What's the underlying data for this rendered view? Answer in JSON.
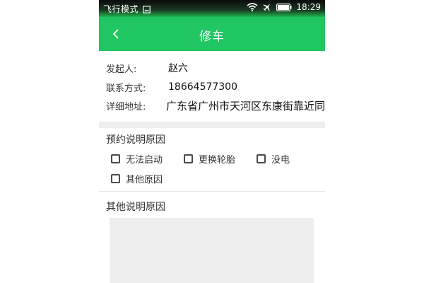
{
  "status_bar": {
    "left_text": "飞行模式",
    "time": "18:29",
    "icons": [
      "image-icon",
      "wifi-icon",
      "airplane-icon",
      "battery-icon"
    ]
  },
  "app_bar": {
    "title": "修车",
    "back_icon": "chevron-left-icon",
    "color": "#1fc661"
  },
  "info": {
    "initiator_label": "发起人:",
    "initiator_value": "赵六",
    "contact_label": "联系方式:",
    "contact_value": "18664577300",
    "address_label": "详细地址:",
    "address_value": "广东省广州市天河区东康街靠近同"
  },
  "reason_section": {
    "title": "预约说明原因",
    "options": [
      {
        "label": "无法启动",
        "checked": false
      },
      {
        "label": "更换轮胎",
        "checked": false
      },
      {
        "label": "没电",
        "checked": false
      },
      {
        "label": "其他原因",
        "checked": false
      }
    ]
  },
  "other_section": {
    "title": "其他说明原因",
    "text": ""
  }
}
